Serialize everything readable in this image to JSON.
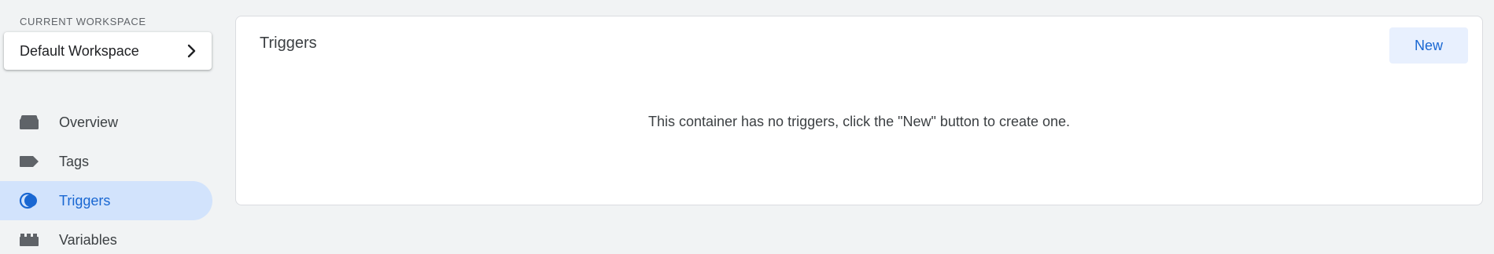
{
  "sidebar": {
    "workspace_label": "CURRENT WORKSPACE",
    "workspace_name": "Default Workspace",
    "items": [
      {
        "label": "Overview",
        "icon": "overview-icon",
        "active": false
      },
      {
        "label": "Tags",
        "icon": "tag-icon",
        "active": false
      },
      {
        "label": "Triggers",
        "icon": "trigger-icon",
        "active": true
      },
      {
        "label": "Variables",
        "icon": "variables-icon",
        "active": false
      }
    ]
  },
  "main": {
    "title": "Triggers",
    "new_button_label": "New",
    "empty_message": "This container has no triggers, click the \"New\" button to create one."
  },
  "colors": {
    "background": "#f1f3f4",
    "accent": "#1967d2",
    "active_nav_bg": "#d2e3fc",
    "button_bg": "#e8f0fe",
    "icon_gray": "#5f6368"
  }
}
